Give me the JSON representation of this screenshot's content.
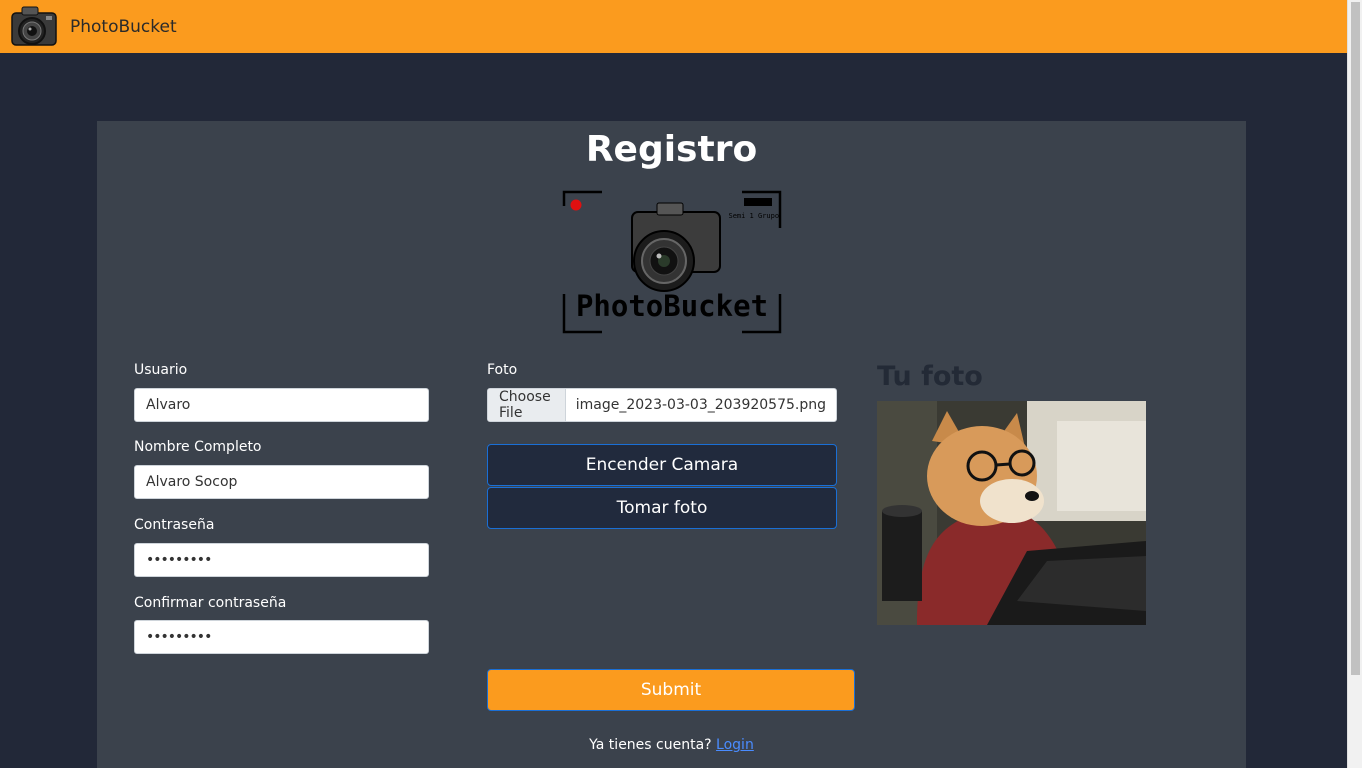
{
  "app": {
    "brand": "PhotoBucket",
    "logo_icon": "camera-icon"
  },
  "page": {
    "title": "Registro",
    "logo_text": "PhotoBucket",
    "logo_badge": "Semi 1 Grupo 6"
  },
  "form": {
    "usuario": {
      "label": "Usuario",
      "value": "Alvaro"
    },
    "nombre": {
      "label": "Nombre Completo",
      "value": "Alvaro Socop"
    },
    "password": {
      "label": "Contraseña",
      "value": "•••••••••"
    },
    "confirm": {
      "label": "Confirmar contraseña",
      "value": "•••••••••"
    },
    "foto": {
      "label": "Foto",
      "button": "Choose File",
      "filename": "image_2023-03-03_203920575.png"
    },
    "camera_on_label": "Encender Camara",
    "take_photo_label": "Tomar foto",
    "submit_label": "Submit"
  },
  "preview": {
    "title": "Tu foto",
    "image_icon": "dog-photo"
  },
  "footer": {
    "question": "Ya tienes cuenta?",
    "login_link": "Login"
  },
  "colors": {
    "accent": "#fb9b1e",
    "background": "#222838",
    "card": "#3b424c",
    "button_dark": "#212a3d",
    "link": "#4a8cff"
  }
}
